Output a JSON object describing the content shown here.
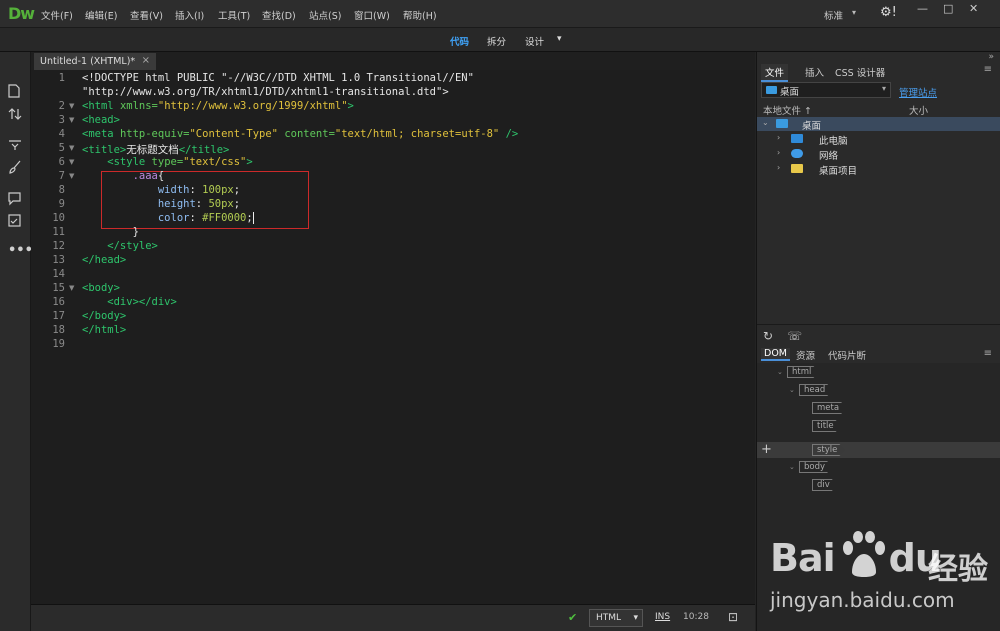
{
  "app": {
    "logo": "Dw"
  },
  "menubar": {
    "items": [
      "文件(F)",
      "编辑(E)",
      "查看(V)",
      "插入(I)",
      "工具(T)",
      "查找(D)",
      "站点(S)",
      "窗口(W)",
      "帮助(H)"
    ],
    "workspace": "标准",
    "workspace_caret": "▾",
    "gear": "⚙!",
    "minimize": "—",
    "maximize": "□",
    "close": "✕"
  },
  "viewbar": {
    "code": "代码",
    "split": "拆分",
    "design": "设计",
    "caret": "▾"
  },
  "document": {
    "tab_label": "Untitled-1 (XHTML)*",
    "close": "×"
  },
  "editor": {
    "line_numbers": [
      "1",
      "2",
      "3",
      "4",
      "5",
      "6",
      "7",
      "8",
      "9",
      "10",
      "11",
      "12",
      "13",
      "14",
      "15",
      "16",
      "17",
      "18",
      "19"
    ],
    "lines": {
      "l1a": "<!DOCTYPE html PUBLIC \"-//W3C//DTD XHTML 1.0 Transitional//EN\"",
      "l1b": "\"http://www.w3.org/TR/xhtml1/DTD/xhtml1-transitional.dtd\">",
      "l2_open": "<html ",
      "l2_attr": "xmlns=",
      "l2_val": "\"http://www.w3.org/1999/xhtml\"",
      "l2_close": ">",
      "l3": "<head>",
      "l4_open": "<meta ",
      "l4_attr1": "http-equiv=",
      "l4_val1": "\"Content-Type\" ",
      "l4_attr2": "content=",
      "l4_val2": "\"text/html; charset=utf-8\" ",
      "l4_close": "/>",
      "l5_open": "<title>",
      "l5_text": "无标题文档",
      "l5_close": "</title>",
      "l6_open": "    <style ",
      "l6_attr": "type=",
      "l6_val": "\"text/css\"",
      "l6_close": ">",
      "l7_sel": "        .aaa",
      "l7_brace": "{",
      "l8_prop": "            width",
      "l8_colon": ": ",
      "l8_val": "100px",
      "l8_semi": ";",
      "l9_prop": "            height",
      "l9_colon": ": ",
      "l9_val": "50px",
      "l9_semi": ";",
      "l10_prop": "            color",
      "l10_colon": ": ",
      "l10_val": "#FF0000",
      "l10_semi": ";",
      "l11": "        }",
      "l12": "    </style>",
      "l13": "</head>",
      "l15": "<body>",
      "l16": "    <div></div>",
      "l17": "</body>",
      "l18": "</html>"
    }
  },
  "status": {
    "ok_icon": "✔",
    "language": "HTML",
    "lang_caret": "▾",
    "ins": "INS",
    "position": "10:28",
    "preview_icon": "⊡"
  },
  "files_panel": {
    "tabs": [
      "文件",
      "插入",
      "CSS 设计器"
    ],
    "menu_icon": "≡",
    "site": "桌面",
    "manage": "管理站点",
    "col_local": "本地文件 ↑",
    "col_size": "大小",
    "tree": [
      {
        "label": "桌面",
        "color": "#3a9be0"
      },
      {
        "label": "此电脑",
        "color": "#2f8ad8"
      },
      {
        "label": "网络",
        "color": "#3f9be8"
      },
      {
        "label": "桌面项目",
        "color": "#e8c84a"
      }
    ],
    "refresh_icon": "↻",
    "connect_icon": "☏"
  },
  "dom_panel": {
    "tabs": [
      "DOM",
      "资源",
      "代码片断"
    ],
    "menu_icon": "≡",
    "plus": "+",
    "nodes": [
      "html",
      "head",
      "meta",
      "title",
      "style",
      "body",
      "div"
    ]
  },
  "watermark": {
    "logo": "Bai",
    "logo2": "du",
    "cn": "经验",
    "url": "jingyan.baidu.com"
  }
}
